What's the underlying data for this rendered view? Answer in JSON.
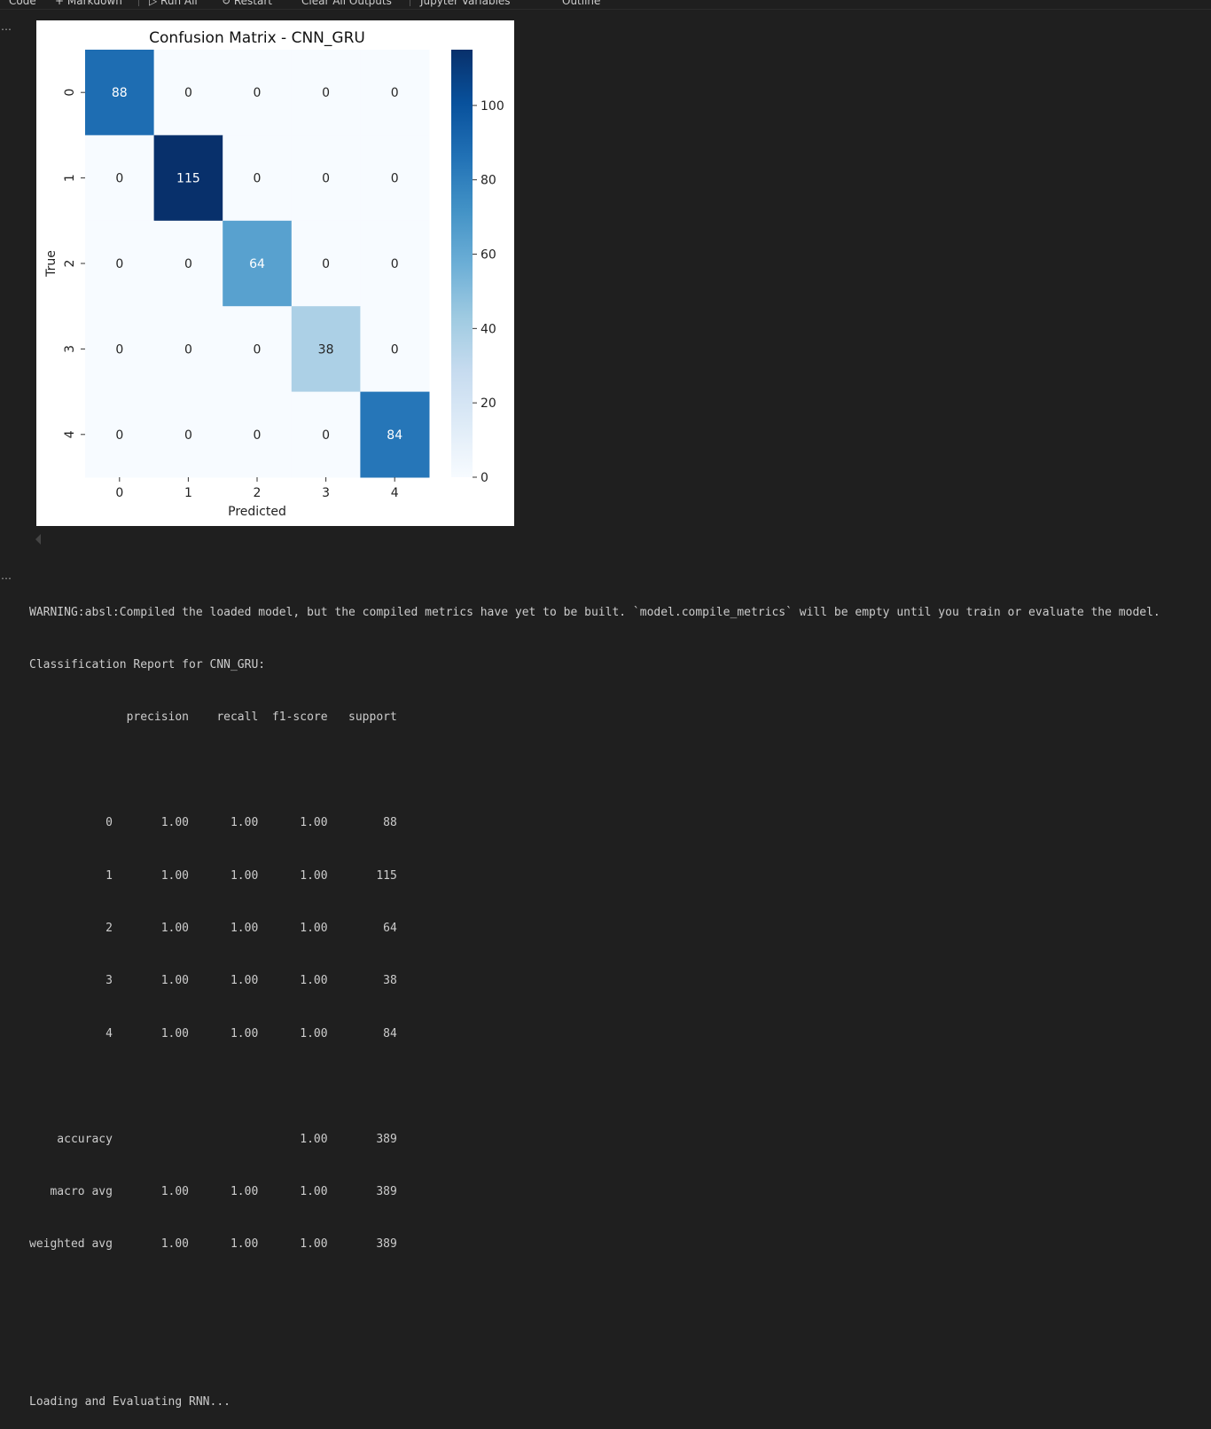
{
  "toolbar": {
    "items": [
      "Code",
      "+ Markdown",
      "▷ Run All",
      "↻ Restart",
      "Clear All Outputs",
      "Jupyter Variables",
      "Outline"
    ]
  },
  "output_markers": [
    "…",
    "…"
  ],
  "chart_data": {
    "type": "heatmap",
    "title": "Confusion Matrix - CNN_GRU",
    "xlabel": "Predicted",
    "ylabel": "True",
    "x_categories": [
      "0",
      "1",
      "2",
      "3",
      "4"
    ],
    "y_categories": [
      "0",
      "1",
      "2",
      "3",
      "4"
    ],
    "values": [
      [
        88,
        0,
        0,
        0,
        0
      ],
      [
        0,
        115,
        0,
        0,
        0
      ],
      [
        0,
        0,
        64,
        0,
        0
      ],
      [
        0,
        0,
        0,
        38,
        0
      ],
      [
        0,
        0,
        0,
        0,
        84
      ]
    ],
    "colormap": "Blues",
    "vmin": 0,
    "vmax": 115,
    "colorbar_ticks": [
      0,
      20,
      40,
      60,
      80,
      100
    ],
    "annotations": true
  },
  "console": {
    "warning": "WARNING:absl:Compiled the loaded model, but the compiled metrics have yet to be built. `model.compile_metrics` will be empty until you train or evaluate the model.",
    "report_title": "Classification Report for CNN_GRU:",
    "header": "              precision    recall  f1-score   support",
    "blank1": "",
    "rows": [
      "           0       1.00      1.00      1.00        88",
      "           1       1.00      1.00      1.00       115",
      "           2       1.00      1.00      1.00        64",
      "           3       1.00      1.00      1.00        38",
      "           4       1.00      1.00      1.00        84"
    ],
    "blank2": "",
    "accuracy": "    accuracy                           1.00       389",
    "macro": "   macro avg       1.00      1.00      1.00       389",
    "weighted": "weighted avg       1.00      1.00      1.00       389",
    "blank3": "",
    "blank4": "",
    "loading": "Loading and Evaluating RNN..."
  }
}
